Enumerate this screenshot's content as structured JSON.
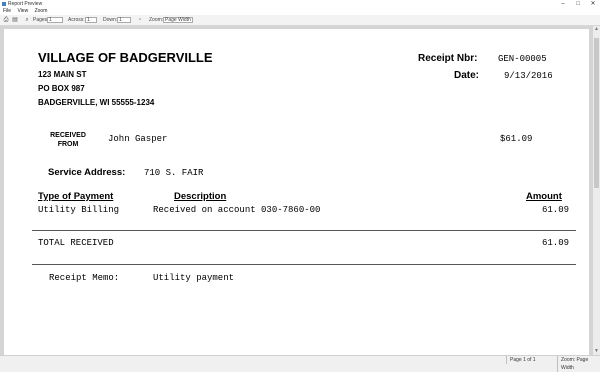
{
  "window": {
    "title": "Report Preview"
  },
  "menu": [
    "File",
    "View",
    "Zoom"
  ],
  "toolbar": {
    "pages_label": "Pages:",
    "pages_value": "1",
    "across_label": "Across:",
    "across_value": "1",
    "down_label": "Down:",
    "down_value": "1",
    "zoom_label": "Zoom:",
    "zoom_value": "Page Width"
  },
  "status": {
    "page": "Page 1 of 1",
    "zoom": "Zoom: Page Width"
  },
  "receipt": {
    "org_name": "VILLAGE OF BADGERVILLE",
    "address_line1": "123 MAIN ST",
    "address_line2": "PO BOX 987",
    "address_line3": "BADGERVILLE, WI 55555-1234",
    "receipt_nbr_label": "Receipt Nbr:",
    "receipt_nbr": "GEN-00005",
    "date_label": "Date:",
    "date": "9/13/2016",
    "received_from_label_1": "RECEIVED",
    "received_from_label_2": "FROM",
    "received_from": "John Gasper",
    "total_top": "$61.09",
    "service_address_label": "Service Address:",
    "service_address": "710 S. FAIR",
    "col_type": "Type of Payment",
    "col_description": "Description",
    "col_amount": "Amount",
    "lines": [
      {
        "type": "Utility Billing",
        "description": "Received on account 030-7860-00",
        "amount": "61.09"
      }
    ],
    "total_label": "TOTAL RECEIVED",
    "total_amount": "61.09",
    "memo_label": "Receipt Memo:",
    "memo": "Utility payment"
  }
}
